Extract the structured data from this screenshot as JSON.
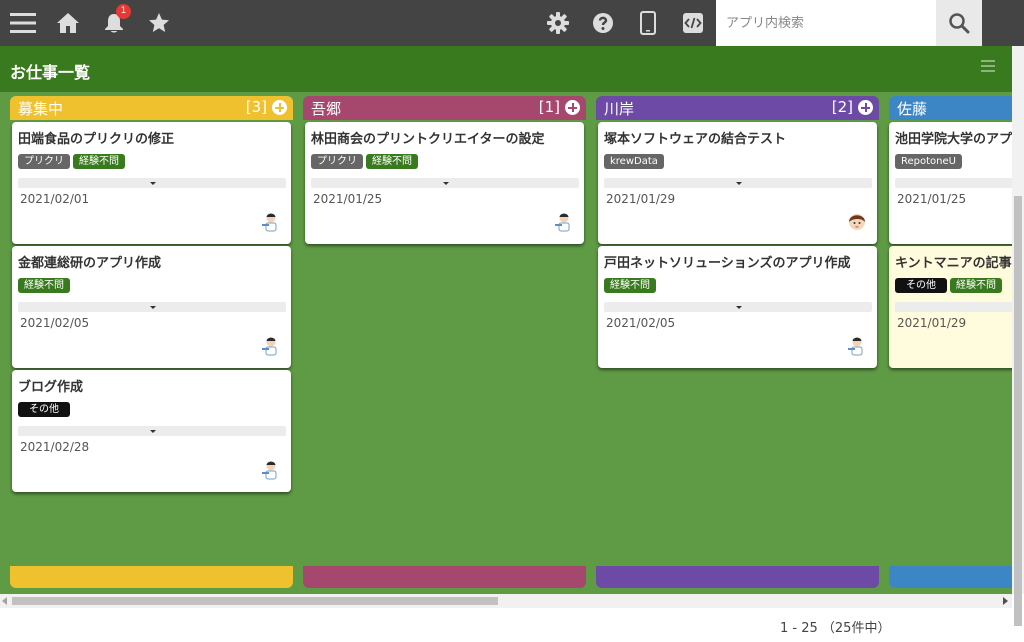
{
  "header": {
    "notification_count": "1",
    "search_placeholder": "アプリ内検索"
  },
  "page": {
    "title": "お仕事一覧",
    "pager": "1 - 25 （25件中）"
  },
  "colors": {
    "toolbar": "#444444",
    "title_bar": "#3a7a1e",
    "board": "#5f9b45"
  },
  "columns": [
    {
      "name": "募集中",
      "count": "[3]",
      "color": "#f0c12f",
      "cards": [
        {
          "title": "田端食品のプリクリの修正",
          "tags": [
            {
              "label": "プリクリ",
              "style": "gray"
            },
            {
              "label": "経験不問",
              "style": "green"
            }
          ],
          "date": "2021/02/01",
          "avatar": "person-a"
        },
        {
          "title": "金都連総研のアプリ作成",
          "tags": [
            {
              "label": "経験不問",
              "style": "green"
            }
          ],
          "date": "2021/02/05",
          "avatar": "person-a"
        },
        {
          "title": "ブログ作成",
          "tags": [
            {
              "label": "その他",
              "style": "black"
            }
          ],
          "date": "2021/02/28",
          "avatar": "person-a"
        }
      ]
    },
    {
      "name": "吾郷",
      "count": "[1]",
      "color": "#a6476e",
      "cards": [
        {
          "title": "林田商会のプリントクリエイターの設定",
          "tags": [
            {
              "label": "プリクリ",
              "style": "gray"
            },
            {
              "label": "経験不問",
              "style": "green"
            }
          ],
          "date": "2021/01/25",
          "avatar": "person-a"
        }
      ]
    },
    {
      "name": "川岸",
      "count": "[2]",
      "color": "#6d4aa6",
      "cards": [
        {
          "title": "塚本ソフトウェアの結合テスト",
          "tags": [
            {
              "label": "krewData",
              "style": "gray"
            }
          ],
          "date": "2021/01/29",
          "avatar": "person-b"
        },
        {
          "title": "戸田ネットソリューションズのアプリ作成",
          "tags": [
            {
              "label": "経験不問",
              "style": "green"
            }
          ],
          "date": "2021/02/05",
          "avatar": "person-a"
        }
      ]
    },
    {
      "name": "佐藤",
      "count": "",
      "color": "#3d86c6",
      "cards": [
        {
          "title": "池田学院大学のアプ",
          "tags": [
            {
              "label": "RepotoneU",
              "style": "gray"
            }
          ],
          "date": "2021/01/25",
          "avatar": "",
          "highlight": false
        },
        {
          "title": "キントマニアの記事",
          "tags": [
            {
              "label": "その他",
              "style": "black"
            },
            {
              "label": "経験不問",
              "style": "green"
            }
          ],
          "date": "2021/01/29",
          "avatar": "",
          "highlight": true
        }
      ]
    }
  ]
}
